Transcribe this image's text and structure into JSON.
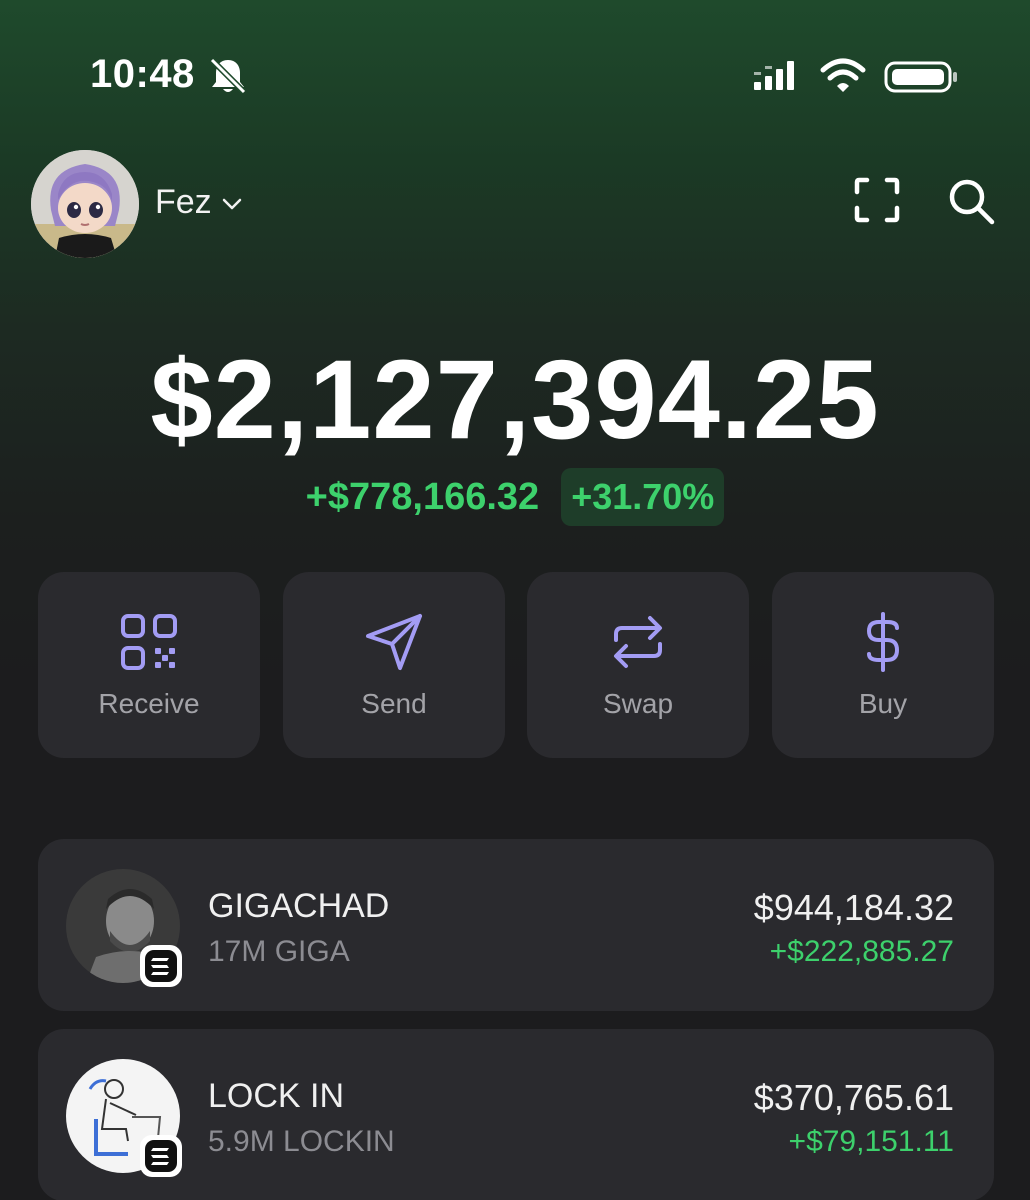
{
  "status_bar": {
    "time": "10:48",
    "icons": [
      "bell-slash-icon",
      "cellular-signal-icon",
      "wifi-icon",
      "battery-icon"
    ]
  },
  "header": {
    "account_name": "Fez",
    "icons": [
      "avatar",
      "chevron-down-icon",
      "scan-icon",
      "search-icon"
    ]
  },
  "portfolio": {
    "balance": "$2,127,394.25",
    "change_amount": "+$778,166.32",
    "change_percent": "+31.70%"
  },
  "actions": [
    {
      "label": "Receive",
      "icon": "qr-code-icon"
    },
    {
      "label": "Send",
      "icon": "send-icon"
    },
    {
      "label": "Swap",
      "icon": "swap-icon"
    },
    {
      "label": "Buy",
      "icon": "dollar-icon"
    }
  ],
  "tokens": [
    {
      "name": "GIGACHAD",
      "amount": "17M GIGA",
      "value": "$944,184.32",
      "change": "+$222,885.27"
    },
    {
      "name": "LOCK IN",
      "amount": "5.9M LOCKIN",
      "value": "$370,765.61",
      "change": "+$79,151.11"
    }
  ],
  "colors": {
    "background": "#1c1c1e",
    "header_gradient_top": "#1f4a2c",
    "card": "#2a2a2e",
    "positive": "#3dd16c",
    "accent_purple": "#a39cf4",
    "muted_text": "#8c8c92"
  }
}
